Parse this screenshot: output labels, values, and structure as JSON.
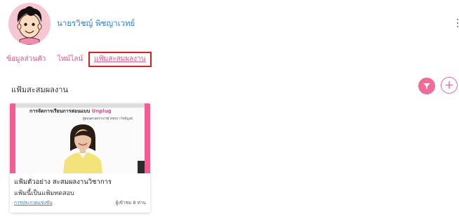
{
  "profile": {
    "name": "นายรวิชญ์ พิชญาเวทย์"
  },
  "tabs": [
    {
      "label": "ข้อมูลส่วนตัว"
    },
    {
      "label": "ไทม์ไลน์"
    },
    {
      "label": "แฟ้มสะสมผลงาน"
    }
  ],
  "section": {
    "title": "แฟ้มสะสมผลงาน",
    "add_symbol": "+"
  },
  "card": {
    "thumbnail_title_prefix": "การจัดการเรียนการสอนแบบ",
    "thumbnail_title_accent": "Unplug",
    "thumbnail_subtitle": "ผู้สอนศาสตราจารย์ พัชรภา กิจพิบูลย์",
    "title": "แฟ้มตัวอย่าง สะสมผลงานวิชาการ",
    "description": "แฟ้มนี้เป็นแฟ้มทดสอบ",
    "category_link": "การประกวดแข่งขัน",
    "views": "ผู้เข้าชม 8 ท่าน"
  },
  "colors": {
    "accent_pink": "#f06b95",
    "link_blue": "#2e7fd1",
    "active_border": "#e01b24"
  }
}
